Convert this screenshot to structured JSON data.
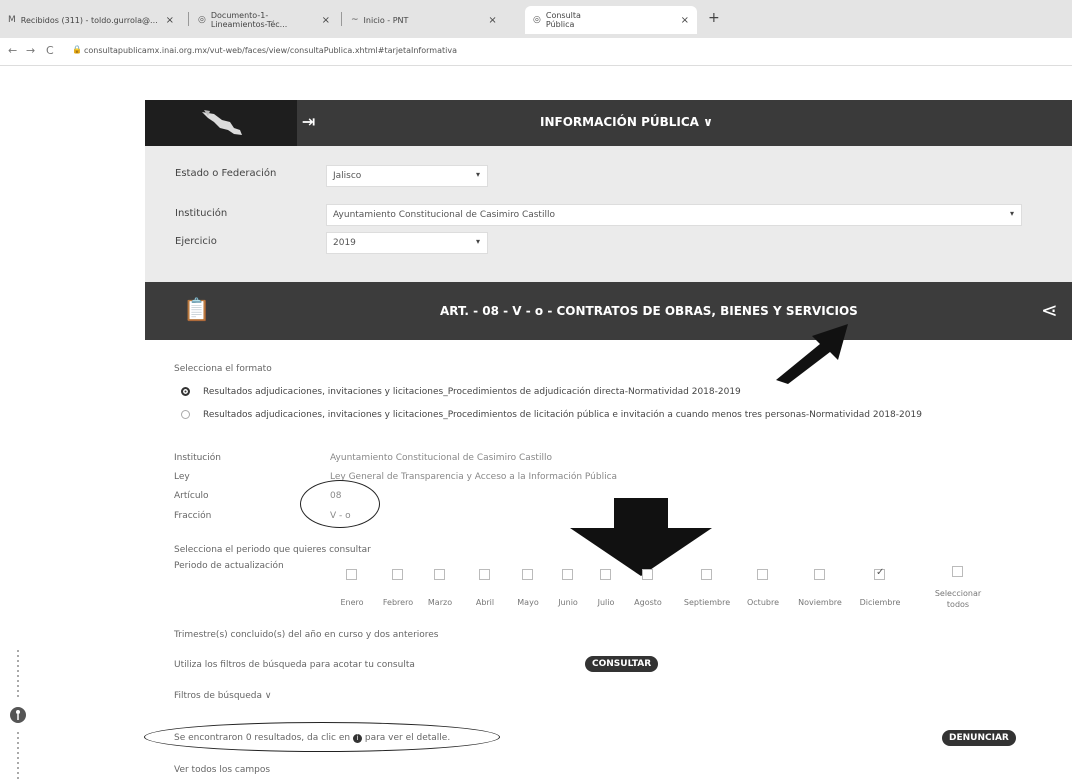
{
  "browser": {
    "tabs": [
      {
        "label": "Recibidos (311) - toldo.gurrola@...",
        "fav": "M"
      },
      {
        "label": "Documento-1-Lineamientos-Téc...",
        "fav": "◎"
      },
      {
        "label": "Inicio - PNT",
        "fav": "~"
      },
      {
        "label": "Consulta Pública",
        "fav": "◎"
      }
    ],
    "new_tab": "+",
    "url": "consultapublicamx.inai.org.mx/vut-web/faces/view/consultaPublica.xhtml#tarjetaInformativa"
  },
  "header": {
    "title": "INFORMACIÓN PÚBLICA",
    "caret": "∨"
  },
  "form": {
    "estado_label": "Estado o Federación",
    "estado_value": "Jalisco",
    "institucion_label": "Institución",
    "institucion_value": "Ayuntamiento Constitucional de Casimiro Castillo",
    "ejercicio_label": "Ejercicio",
    "ejercicio_value": "2019"
  },
  "article": {
    "title": "ART. - 08 - V - o - CONTRATOS DE OBRAS, BIENES Y SERVICIOS"
  },
  "format": {
    "prompt": "Selecciona el formato",
    "options": [
      {
        "label": "Resultados adjudicaciones, invitaciones y licitaciones_Procedimientos de adjudicación directa-Normatividad 2018-2019",
        "selected": true
      },
      {
        "label": "Resultados adjudicaciones, invitaciones y licitaciones_Procedimientos de licitación pública e invitación a cuando menos tres personas-Normatividad 2018-2019",
        "selected": false
      }
    ]
  },
  "details": {
    "institucion_label": "Institución",
    "institucion_value": "Ayuntamiento Constitucional de Casimiro Castillo",
    "ley_label": "Ley",
    "ley_value": "Ley General de Transparencia y Acceso a la Información Pública",
    "articulo_label": "Artículo",
    "articulo_value": "08",
    "fraccion_label": "Fracción",
    "fraccion_value": "V - o"
  },
  "period": {
    "prompt": "Selecciona el periodo que quieres consultar",
    "label": "Periodo de actualización",
    "months": [
      {
        "label": "Enero",
        "checked": false
      },
      {
        "label": "Febrero",
        "checked": false
      },
      {
        "label": "Marzo",
        "checked": false
      },
      {
        "label": "Abril",
        "checked": false
      },
      {
        "label": "Mayo",
        "checked": false
      },
      {
        "label": "Junio",
        "checked": false
      },
      {
        "label": "Julio",
        "checked": false
      },
      {
        "label": "Agosto",
        "checked": false
      },
      {
        "label": "Septiembre",
        "checked": false
      },
      {
        "label": "Octubre",
        "checked": false
      },
      {
        "label": "Noviembre",
        "checked": false
      },
      {
        "label": "Diciembre",
        "checked": true
      }
    ],
    "select_all_line1": "Seleccionar",
    "select_all_line2": "todos",
    "note": "Trimestre(s) concluido(s) del año en curso y dos anteriores"
  },
  "search": {
    "hint": "Utiliza los filtros de búsqueda para acotar tu consulta",
    "consultar": "CONSULTAR",
    "filtros": "Filtros de búsqueda",
    "filtros_caret": "∨",
    "results": "Se encontraron 0 resultados, da clic en",
    "results_tail": "para ver el detalle.",
    "denunciar": "DENUNCIAR",
    "ver_todos": "Ver todos los campos"
  }
}
